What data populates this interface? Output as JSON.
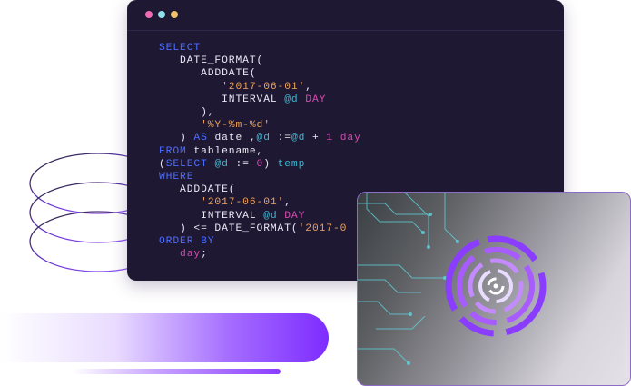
{
  "editor": {
    "window_dots": [
      {
        "name": "close",
        "color": "#f06bb5"
      },
      {
        "name": "minimize",
        "color": "#8fe0ea"
      },
      {
        "name": "maximize",
        "color": "#f2c26b"
      }
    ],
    "code_lines": [
      "SELECT",
      "   DATE_FORMAT(",
      "      ADDDATE(",
      "         '2017-06-01',",
      "         INTERVAL @d DAY",
      "      ),",
      "      '%Y-%m-%d'",
      "   ) AS date ,@d :=@d + 1 day",
      "FROM tablename,",
      "(SELECT @d := 0) temp",
      "WHERE",
      "   ADDDATE(",
      "      '2017-06-01',",
      "      INTERVAL @d DAY",
      "   ) <= DATE_FORMAT('2017-0",
      "ORDER BY",
      "   day;"
    ]
  },
  "colors": {
    "editor_bg": "#1f1833",
    "keyword": "#4d6dff",
    "string": "#f0a25a",
    "variable": "#3fb8d0",
    "operator": "#d64ab0",
    "accent_purple": "#7e2cff"
  },
  "decorations": {
    "rings": "spiral-rings-icon",
    "card_logo": "fingerprint-maze-icon"
  }
}
